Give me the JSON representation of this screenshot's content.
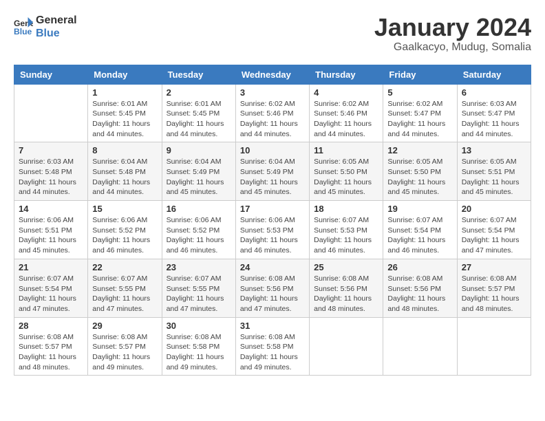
{
  "header": {
    "logo_line1": "General",
    "logo_line2": "Blue",
    "month": "January 2024",
    "location": "Gaalkacyo, Mudug, Somalia"
  },
  "weekdays": [
    "Sunday",
    "Monday",
    "Tuesday",
    "Wednesday",
    "Thursday",
    "Friday",
    "Saturday"
  ],
  "weeks": [
    [
      {
        "day": "",
        "sunrise": "",
        "sunset": "",
        "daylight": ""
      },
      {
        "day": "1",
        "sunrise": "Sunrise: 6:01 AM",
        "sunset": "Sunset: 5:45 PM",
        "daylight": "Daylight: 11 hours and 44 minutes."
      },
      {
        "day": "2",
        "sunrise": "Sunrise: 6:01 AM",
        "sunset": "Sunset: 5:45 PM",
        "daylight": "Daylight: 11 hours and 44 minutes."
      },
      {
        "day": "3",
        "sunrise": "Sunrise: 6:02 AM",
        "sunset": "Sunset: 5:46 PM",
        "daylight": "Daylight: 11 hours and 44 minutes."
      },
      {
        "day": "4",
        "sunrise": "Sunrise: 6:02 AM",
        "sunset": "Sunset: 5:46 PM",
        "daylight": "Daylight: 11 hours and 44 minutes."
      },
      {
        "day": "5",
        "sunrise": "Sunrise: 6:02 AM",
        "sunset": "Sunset: 5:47 PM",
        "daylight": "Daylight: 11 hours and 44 minutes."
      },
      {
        "day": "6",
        "sunrise": "Sunrise: 6:03 AM",
        "sunset": "Sunset: 5:47 PM",
        "daylight": "Daylight: 11 hours and 44 minutes."
      }
    ],
    [
      {
        "day": "7",
        "sunrise": "Sunrise: 6:03 AM",
        "sunset": "Sunset: 5:48 PM",
        "daylight": "Daylight: 11 hours and 44 minutes."
      },
      {
        "day": "8",
        "sunrise": "Sunrise: 6:04 AM",
        "sunset": "Sunset: 5:48 PM",
        "daylight": "Daylight: 11 hours and 44 minutes."
      },
      {
        "day": "9",
        "sunrise": "Sunrise: 6:04 AM",
        "sunset": "Sunset: 5:49 PM",
        "daylight": "Daylight: 11 hours and 45 minutes."
      },
      {
        "day": "10",
        "sunrise": "Sunrise: 6:04 AM",
        "sunset": "Sunset: 5:49 PM",
        "daylight": "Daylight: 11 hours and 45 minutes."
      },
      {
        "day": "11",
        "sunrise": "Sunrise: 6:05 AM",
        "sunset": "Sunset: 5:50 PM",
        "daylight": "Daylight: 11 hours and 45 minutes."
      },
      {
        "day": "12",
        "sunrise": "Sunrise: 6:05 AM",
        "sunset": "Sunset: 5:50 PM",
        "daylight": "Daylight: 11 hours and 45 minutes."
      },
      {
        "day": "13",
        "sunrise": "Sunrise: 6:05 AM",
        "sunset": "Sunset: 5:51 PM",
        "daylight": "Daylight: 11 hours and 45 minutes."
      }
    ],
    [
      {
        "day": "14",
        "sunrise": "Sunrise: 6:06 AM",
        "sunset": "Sunset: 5:51 PM",
        "daylight": "Daylight: 11 hours and 45 minutes."
      },
      {
        "day": "15",
        "sunrise": "Sunrise: 6:06 AM",
        "sunset": "Sunset: 5:52 PM",
        "daylight": "Daylight: 11 hours and 46 minutes."
      },
      {
        "day": "16",
        "sunrise": "Sunrise: 6:06 AM",
        "sunset": "Sunset: 5:52 PM",
        "daylight": "Daylight: 11 hours and 46 minutes."
      },
      {
        "day": "17",
        "sunrise": "Sunrise: 6:06 AM",
        "sunset": "Sunset: 5:53 PM",
        "daylight": "Daylight: 11 hours and 46 minutes."
      },
      {
        "day": "18",
        "sunrise": "Sunrise: 6:07 AM",
        "sunset": "Sunset: 5:53 PM",
        "daylight": "Daylight: 11 hours and 46 minutes."
      },
      {
        "day": "19",
        "sunrise": "Sunrise: 6:07 AM",
        "sunset": "Sunset: 5:54 PM",
        "daylight": "Daylight: 11 hours and 46 minutes."
      },
      {
        "day": "20",
        "sunrise": "Sunrise: 6:07 AM",
        "sunset": "Sunset: 5:54 PM",
        "daylight": "Daylight: 11 hours and 47 minutes."
      }
    ],
    [
      {
        "day": "21",
        "sunrise": "Sunrise: 6:07 AM",
        "sunset": "Sunset: 5:54 PM",
        "daylight": "Daylight: 11 hours and 47 minutes."
      },
      {
        "day": "22",
        "sunrise": "Sunrise: 6:07 AM",
        "sunset": "Sunset: 5:55 PM",
        "daylight": "Daylight: 11 hours and 47 minutes."
      },
      {
        "day": "23",
        "sunrise": "Sunrise: 6:07 AM",
        "sunset": "Sunset: 5:55 PM",
        "daylight": "Daylight: 11 hours and 47 minutes."
      },
      {
        "day": "24",
        "sunrise": "Sunrise: 6:08 AM",
        "sunset": "Sunset: 5:56 PM",
        "daylight": "Daylight: 11 hours and 47 minutes."
      },
      {
        "day": "25",
        "sunrise": "Sunrise: 6:08 AM",
        "sunset": "Sunset: 5:56 PM",
        "daylight": "Daylight: 11 hours and 48 minutes."
      },
      {
        "day": "26",
        "sunrise": "Sunrise: 6:08 AM",
        "sunset": "Sunset: 5:56 PM",
        "daylight": "Daylight: 11 hours and 48 minutes."
      },
      {
        "day": "27",
        "sunrise": "Sunrise: 6:08 AM",
        "sunset": "Sunset: 5:57 PM",
        "daylight": "Daylight: 11 hours and 48 minutes."
      }
    ],
    [
      {
        "day": "28",
        "sunrise": "Sunrise: 6:08 AM",
        "sunset": "Sunset: 5:57 PM",
        "daylight": "Daylight: 11 hours and 48 minutes."
      },
      {
        "day": "29",
        "sunrise": "Sunrise: 6:08 AM",
        "sunset": "Sunset: 5:57 PM",
        "daylight": "Daylight: 11 hours and 49 minutes."
      },
      {
        "day": "30",
        "sunrise": "Sunrise: 6:08 AM",
        "sunset": "Sunset: 5:58 PM",
        "daylight": "Daylight: 11 hours and 49 minutes."
      },
      {
        "day": "31",
        "sunrise": "Sunrise: 6:08 AM",
        "sunset": "Sunset: 5:58 PM",
        "daylight": "Daylight: 11 hours and 49 minutes."
      },
      {
        "day": "",
        "sunrise": "",
        "sunset": "",
        "daylight": ""
      },
      {
        "day": "",
        "sunrise": "",
        "sunset": "",
        "daylight": ""
      },
      {
        "day": "",
        "sunrise": "",
        "sunset": "",
        "daylight": ""
      }
    ]
  ]
}
